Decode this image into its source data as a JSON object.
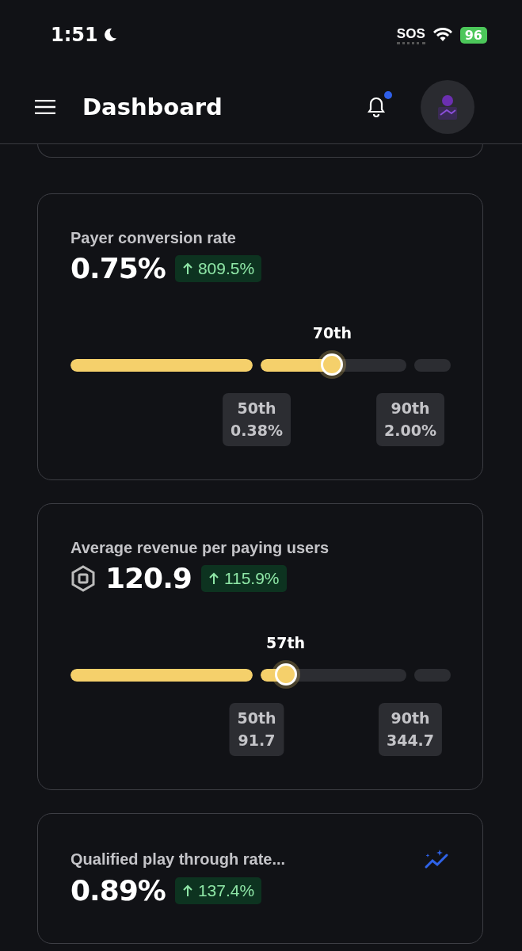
{
  "status_bar": {
    "time": "1:51",
    "sos": "SOS",
    "battery": "96"
  },
  "header": {
    "title": "Dashboard",
    "notification_dot": true
  },
  "cards": [
    {
      "title": "Payer conversion rate",
      "value": "0.75%",
      "change": "809.5%",
      "slider": {
        "level": 0.7,
        "percentile": "70th",
        "markers": [
          {
            "label": "50th",
            "value": "0.38%"
          },
          {
            "label": "90th",
            "value": "2.00%"
          }
        ]
      }
    },
    {
      "title": "Average revenue per paying users",
      "value": "120.9",
      "currency_icon": true,
      "change": "115.9%",
      "slider": {
        "level": 0.57,
        "percentile": "57th",
        "markers": [
          {
            "label": "50th",
            "value": "91.7"
          },
          {
            "label": "90th",
            "value": "344.7"
          }
        ]
      }
    },
    {
      "title": "Qualified play through rate...",
      "value": "0.89%",
      "change": "137.4%",
      "insights_icon": true
    }
  ]
}
